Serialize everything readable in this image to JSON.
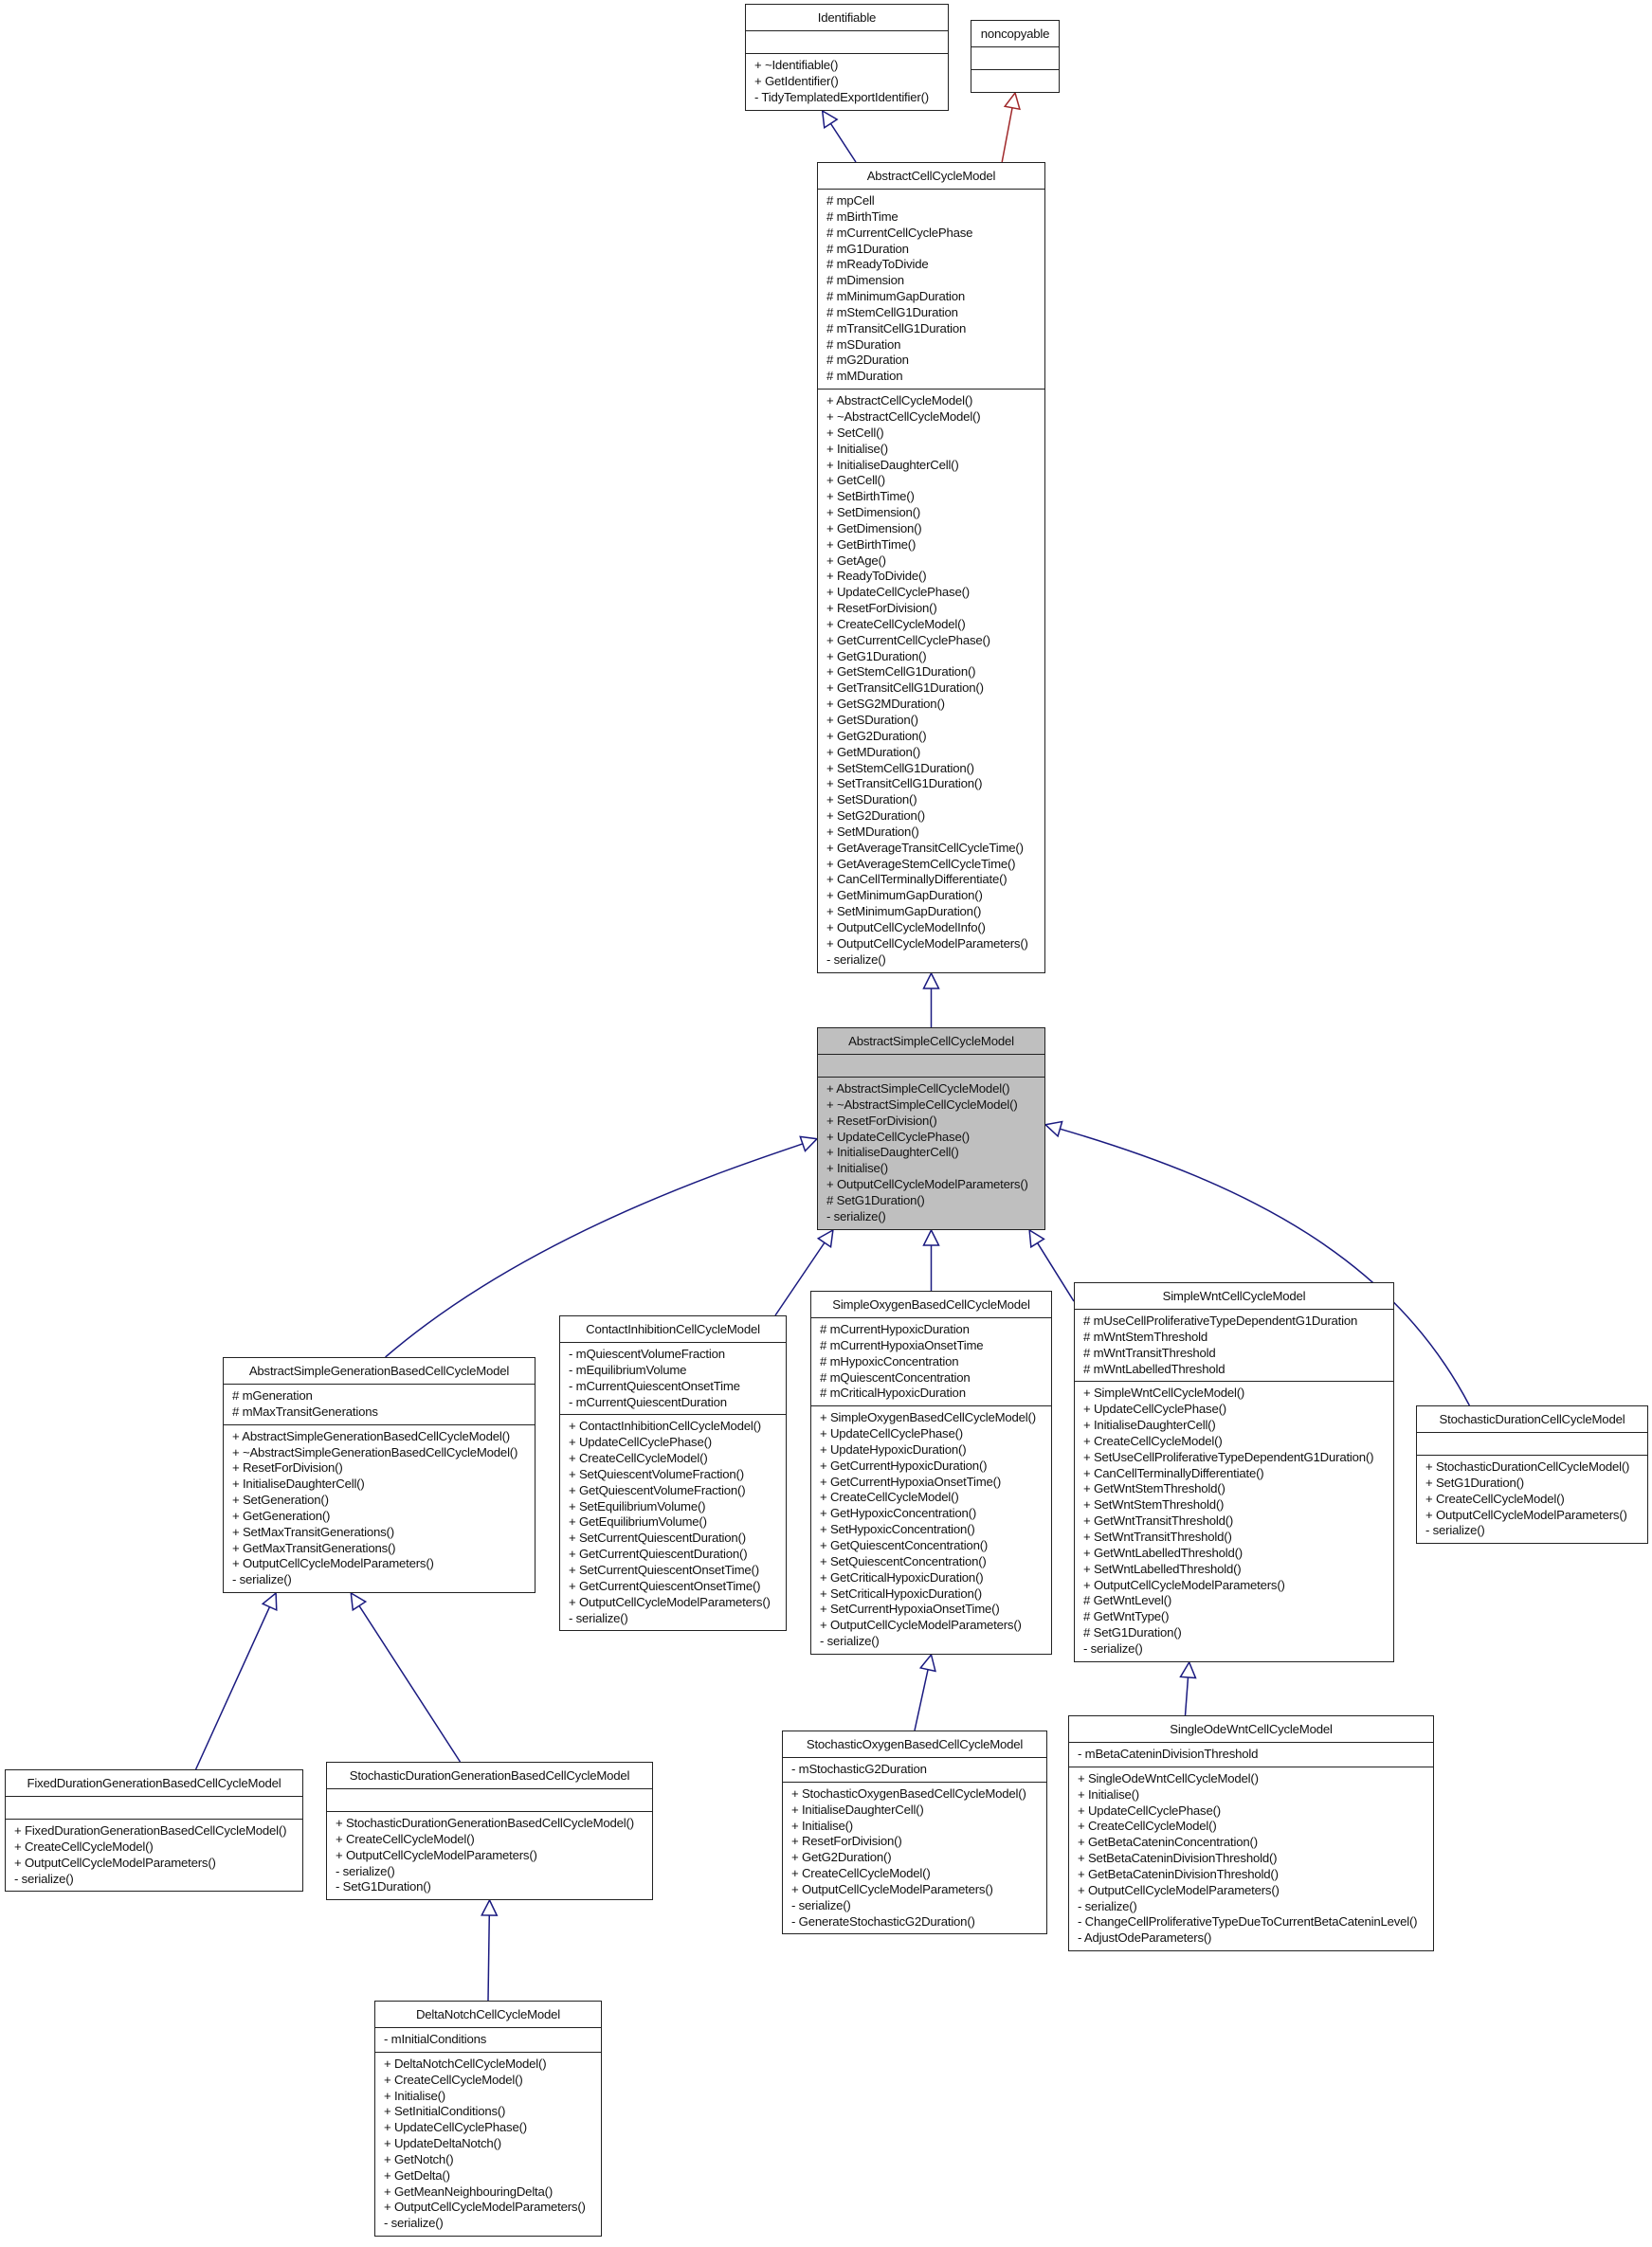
{
  "diagram": {
    "type": "uml-inheritance",
    "focus_class": "AbstractSimpleCellCycleModel",
    "colors": {
      "inheritance_edge": "#1a1a80",
      "external_edge": "#a0282a",
      "focus_fill": "#bfbfbf",
      "box_fill": "#ffffff",
      "border": "#222222"
    }
  },
  "classes": [
    {
      "id": "Identifiable",
      "name": "Identifiable",
      "attributes": [],
      "methods": [
        "+ ~Identifiable()",
        "+ GetIdentifier()",
        "- TidyTemplatedExportIdentifier()"
      ]
    },
    {
      "id": "noncopyable",
      "name": "noncopyable",
      "attributes": [],
      "methods": []
    },
    {
      "id": "AbstractCellCycleModel",
      "name": "AbstractCellCycleModel",
      "attributes": [
        "# mpCell",
        "# mBirthTime",
        "# mCurrentCellCyclePhase",
        "# mG1Duration",
        "# mReadyToDivide",
        "# mDimension",
        "# mMinimumGapDuration",
        "# mStemCellG1Duration",
        "# mTransitCellG1Duration",
        "# mSDuration",
        "# mG2Duration",
        "# mMDuration"
      ],
      "methods": [
        "+ AbstractCellCycleModel()",
        "+ ~AbstractCellCycleModel()",
        "+ SetCell()",
        "+ Initialise()",
        "+ InitialiseDaughterCell()",
        "+ GetCell()",
        "+ SetBirthTime()",
        "+ SetDimension()",
        "+ GetDimension()",
        "+ GetBirthTime()",
        "+ GetAge()",
        "+ ReadyToDivide()",
        "+ UpdateCellCyclePhase()",
        "+ ResetForDivision()",
        "+ CreateCellCycleModel()",
        "+ GetCurrentCellCyclePhase()",
        "+ GetG1Duration()",
        "+ GetStemCellG1Duration()",
        "+ GetTransitCellG1Duration()",
        "+ GetSG2MDuration()",
        "+ GetSDuration()",
        "+ GetG2Duration()",
        "+ GetMDuration()",
        "+ SetStemCellG1Duration()",
        "+ SetTransitCellG1Duration()",
        "+ SetSDuration()",
        "+ SetG2Duration()",
        "+ SetMDuration()",
        "+ GetAverageTransitCellCycleTime()",
        "+ GetAverageStemCellCycleTime()",
        "+ CanCellTerminallyDifferentiate()",
        "+ GetMinimumGapDuration()",
        "+ SetMinimumGapDuration()",
        "+ OutputCellCycleModelInfo()",
        "+ OutputCellCycleModelParameters()",
        "- serialize()"
      ]
    },
    {
      "id": "AbstractSimpleCellCycleModel",
      "name": "AbstractSimpleCellCycleModel",
      "attributes": [],
      "methods": [
        "+ AbstractSimpleCellCycleModel()",
        "+ ~AbstractSimpleCellCycleModel()",
        "+ ResetForDivision()",
        "+ UpdateCellCyclePhase()",
        "+ InitialiseDaughterCell()",
        "+ Initialise()",
        "+ OutputCellCycleModelParameters()",
        "# SetG1Duration()",
        "- serialize()"
      ]
    },
    {
      "id": "AbstractSimpleGenerationBasedCellCycleModel",
      "name": "AbstractSimpleGenerationBasedCellCycleModel",
      "attributes": [
        "# mGeneration",
        "# mMaxTransitGenerations"
      ],
      "methods": [
        "+ AbstractSimpleGenerationBasedCellCycleModel()",
        "+ ~AbstractSimpleGenerationBasedCellCycleModel()",
        "+ ResetForDivision()",
        "+ InitialiseDaughterCell()",
        "+ SetGeneration()",
        "+ GetGeneration()",
        "+ SetMaxTransitGenerations()",
        "+ GetMaxTransitGenerations()",
        "+ OutputCellCycleModelParameters()",
        "- serialize()"
      ]
    },
    {
      "id": "ContactInhibitionCellCycleModel",
      "name": "ContactInhibitionCellCycleModel",
      "attributes": [
        "- mQuiescentVolumeFraction",
        "- mEquilibriumVolume",
        "- mCurrentQuiescentOnsetTime",
        "- mCurrentQuiescentDuration"
      ],
      "methods": [
        "+ ContactInhibitionCellCycleModel()",
        "+ UpdateCellCyclePhase()",
        "+ CreateCellCycleModel()",
        "+ SetQuiescentVolumeFraction()",
        "+ GetQuiescentVolumeFraction()",
        "+ SetEquilibriumVolume()",
        "+ GetEquilibriumVolume()",
        "+ SetCurrentQuiescentDuration()",
        "+ GetCurrentQuiescentDuration()",
        "+ SetCurrentQuiescentOnsetTime()",
        "+ GetCurrentQuiescentOnsetTime()",
        "+ OutputCellCycleModelParameters()",
        "- serialize()"
      ]
    },
    {
      "id": "SimpleOxygenBasedCellCycleModel",
      "name": "SimpleOxygenBasedCellCycleModel",
      "attributes": [
        "# mCurrentHypoxicDuration",
        "# mCurrentHypoxiaOnsetTime",
        "# mHypoxicConcentration",
        "# mQuiescentConcentration",
        "# mCriticalHypoxicDuration"
      ],
      "methods": [
        "+ SimpleOxygenBasedCellCycleModel()",
        "+ UpdateCellCyclePhase()",
        "+ UpdateHypoxicDuration()",
        "+ GetCurrentHypoxicDuration()",
        "+ GetCurrentHypoxiaOnsetTime()",
        "+ CreateCellCycleModel()",
        "+ GetHypoxicConcentration()",
        "+ SetHypoxicConcentration()",
        "+ GetQuiescentConcentration()",
        "+ SetQuiescentConcentration()",
        "+ GetCriticalHypoxicDuration()",
        "+ SetCriticalHypoxicDuration()",
        "+ SetCurrentHypoxiaOnsetTime()",
        "+ OutputCellCycleModelParameters()",
        "- serialize()"
      ]
    },
    {
      "id": "SimpleWntCellCycleModel",
      "name": "SimpleWntCellCycleModel",
      "attributes": [
        "# mUseCellProliferativeTypeDependentG1Duration",
        "# mWntStemThreshold",
        "# mWntTransitThreshold",
        "# mWntLabelledThreshold"
      ],
      "methods": [
        "+ SimpleWntCellCycleModel()",
        "+ UpdateCellCyclePhase()",
        "+ InitialiseDaughterCell()",
        "+ CreateCellCycleModel()",
        "+ SetUseCellProliferativeTypeDependentG1Duration()",
        "+ CanCellTerminallyDifferentiate()",
        "+ GetWntStemThreshold()",
        "+ SetWntStemThreshold()",
        "+ GetWntTransitThreshold()",
        "+ SetWntTransitThreshold()",
        "+ GetWntLabelledThreshold()",
        "+ SetWntLabelledThreshold()",
        "+ OutputCellCycleModelParameters()",
        "# GetWntLevel()",
        "# GetWntType()",
        "# SetG1Duration()",
        "- serialize()"
      ]
    },
    {
      "id": "StochasticDurationCellCycleModel",
      "name": "StochasticDurationCellCycleModel",
      "attributes": [],
      "methods": [
        "+ StochasticDurationCellCycleModel()",
        "+ SetG1Duration()",
        "+ CreateCellCycleModel()",
        "+ OutputCellCycleModelParameters()",
        "- serialize()"
      ]
    },
    {
      "id": "FixedDurationGenerationBasedCellCycleModel",
      "name": "FixedDurationGenerationBasedCellCycleModel",
      "attributes": [],
      "methods": [
        "+ FixedDurationGenerationBasedCellCycleModel()",
        "+ CreateCellCycleModel()",
        "+ OutputCellCycleModelParameters()",
        "- serialize()"
      ]
    },
    {
      "id": "StochasticDurationGenerationBasedCellCycleModel",
      "name": "StochasticDurationGenerationBasedCellCycleModel",
      "attributes": [],
      "methods": [
        "+ StochasticDurationGenerationBasedCellCycleModel()",
        "+ CreateCellCycleModel()",
        "+ OutputCellCycleModelParameters()",
        "- serialize()",
        "- SetG1Duration()"
      ]
    },
    {
      "id": "StochasticOxygenBasedCellCycleModel",
      "name": "StochasticOxygenBasedCellCycleModel",
      "attributes": [
        "- mStochasticG2Duration"
      ],
      "methods": [
        "+ StochasticOxygenBasedCellCycleModel()",
        "+ InitialiseDaughterCell()",
        "+ Initialise()",
        "+ ResetForDivision()",
        "+ GetG2Duration()",
        "+ CreateCellCycleModel()",
        "+ OutputCellCycleModelParameters()",
        "- serialize()",
        "- GenerateStochasticG2Duration()"
      ]
    },
    {
      "id": "SingleOdeWntCellCycleModel",
      "name": "SingleOdeWntCellCycleModel",
      "attributes": [
        "- mBetaCateninDivisionThreshold"
      ],
      "methods": [
        "+ SingleOdeWntCellCycleModel()",
        "+ Initialise()",
        "+ UpdateCellCyclePhase()",
        "+ CreateCellCycleModel()",
        "+ GetBetaCateninConcentration()",
        "+ SetBetaCateninDivisionThreshold()",
        "+ GetBetaCateninDivisionThreshold()",
        "+ OutputCellCycleModelParameters()",
        "- serialize()",
        "- ChangeCellProliferativeTypeDueToCurrentBetaCateninLevel()",
        "- AdjustOdeParameters()"
      ]
    },
    {
      "id": "DeltaNotchCellCycleModel",
      "name": "DeltaNotchCellCycleModel",
      "attributes": [
        "- mInitialConditions"
      ],
      "methods": [
        "+ DeltaNotchCellCycleModel()",
        "+ CreateCellCycleModel()",
        "+ Initialise()",
        "+ SetInitialConditions()",
        "+ UpdateCellCyclePhase()",
        "+ UpdateDeltaNotch()",
        "+ GetNotch()",
        "+ GetDelta()",
        "+ GetMeanNeighbouringDelta()",
        "+ OutputCellCycleModelParameters()",
        "- serialize()"
      ]
    }
  ],
  "inheritance": [
    {
      "child": "AbstractCellCycleModel",
      "parent": "Identifiable",
      "kind": "internal"
    },
    {
      "child": "AbstractCellCycleModel",
      "parent": "noncopyable",
      "kind": "external"
    },
    {
      "child": "AbstractSimpleCellCycleModel",
      "parent": "AbstractCellCycleModel",
      "kind": "internal"
    },
    {
      "child": "AbstractSimpleGenerationBasedCellCycleModel",
      "parent": "AbstractSimpleCellCycleModel",
      "kind": "internal"
    },
    {
      "child": "ContactInhibitionCellCycleModel",
      "parent": "AbstractSimpleCellCycleModel",
      "kind": "internal"
    },
    {
      "child": "SimpleOxygenBasedCellCycleModel",
      "parent": "AbstractSimpleCellCycleModel",
      "kind": "internal"
    },
    {
      "child": "SimpleWntCellCycleModel",
      "parent": "AbstractSimpleCellCycleModel",
      "kind": "internal"
    },
    {
      "child": "StochasticDurationCellCycleModel",
      "parent": "AbstractSimpleCellCycleModel",
      "kind": "internal"
    },
    {
      "child": "FixedDurationGenerationBasedCellCycleModel",
      "parent": "AbstractSimpleGenerationBasedCellCycleModel",
      "kind": "internal"
    },
    {
      "child": "StochasticDurationGenerationBasedCellCycleModel",
      "parent": "AbstractSimpleGenerationBasedCellCycleModel",
      "kind": "internal"
    },
    {
      "child": "StochasticOxygenBasedCellCycleModel",
      "parent": "SimpleOxygenBasedCellCycleModel",
      "kind": "internal"
    },
    {
      "child": "SingleOdeWntCellCycleModel",
      "parent": "SimpleWntCellCycleModel",
      "kind": "internal"
    },
    {
      "child": "DeltaNotchCellCycleModel",
      "parent": "StochasticDurationGenerationBasedCellCycleModel",
      "kind": "internal"
    }
  ]
}
